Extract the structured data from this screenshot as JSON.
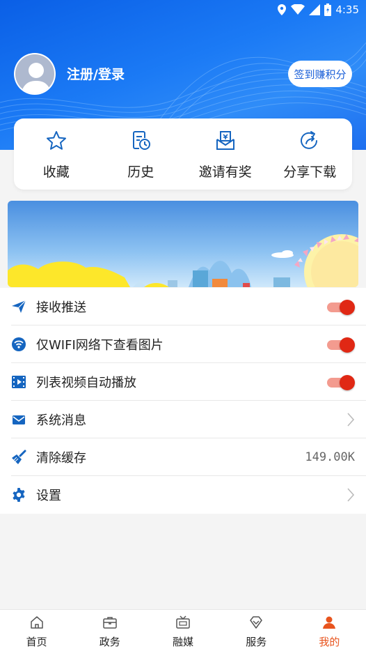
{
  "status_bar": {
    "time": "4:35"
  },
  "profile": {
    "login_text": "注册/登录",
    "signin_button": "签到赚积分"
  },
  "quick_actions": [
    {
      "label": "收藏",
      "icon": "star-icon"
    },
    {
      "label": "历史",
      "icon": "history-icon"
    },
    {
      "label": "邀请有奖",
      "icon": "invite-icon"
    },
    {
      "label": "分享下载",
      "icon": "share-icon"
    }
  ],
  "settings": [
    {
      "label": "接收推送",
      "icon": "send-icon",
      "control": "toggle",
      "on": true
    },
    {
      "label": "仅WIFI网络下查看图片",
      "icon": "wifi-icon",
      "control": "toggle",
      "on": true
    },
    {
      "label": "列表视频自动播放",
      "icon": "video-icon",
      "control": "toggle",
      "on": true
    },
    {
      "label": "系统消息",
      "icon": "mail-icon",
      "control": "chevron"
    },
    {
      "label": "清除缓存",
      "icon": "broom-icon",
      "control": "value",
      "value": "149.00K"
    },
    {
      "label": "设置",
      "icon": "gear-icon",
      "control": "chevron"
    }
  ],
  "tabs": [
    {
      "label": "首页",
      "icon": "home-icon",
      "active": false
    },
    {
      "label": "政务",
      "icon": "briefcase-icon",
      "active": false
    },
    {
      "label": "融媒",
      "icon": "tv-icon",
      "active": false
    },
    {
      "label": "服务",
      "icon": "diamond-icon",
      "active": false
    },
    {
      "label": "我的",
      "icon": "user-icon",
      "active": true
    }
  ],
  "colors": {
    "primary": "#1a6fe8",
    "accent": "#e02814",
    "active_tab": "#e8541e",
    "icon_blue": "#1565c0"
  }
}
